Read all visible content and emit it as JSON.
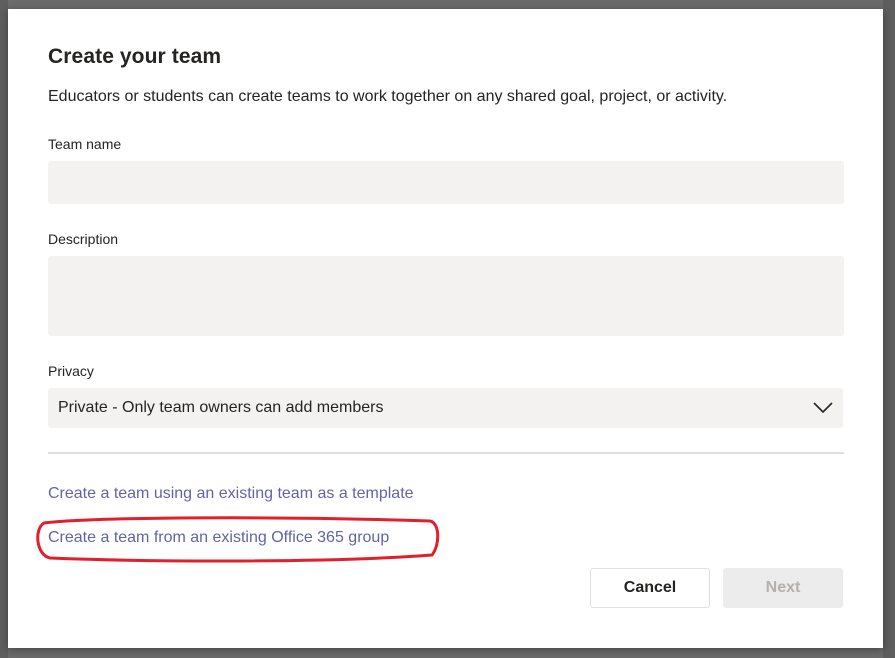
{
  "dialog": {
    "title": "Create your team",
    "subtitle": "Educators or students can create teams to work together on any shared goal, project, or activity."
  },
  "fields": {
    "team_name": {
      "label": "Team name",
      "value": "",
      "placeholder": ""
    },
    "description": {
      "label": "Description",
      "value": "",
      "placeholder": ""
    },
    "privacy": {
      "label": "Privacy",
      "selected": "Private - Only team owners can add members"
    }
  },
  "links": {
    "template": "Create a team using an existing team as a template",
    "office365": "Create a team from an existing Office 365 group"
  },
  "buttons": {
    "cancel": "Cancel",
    "next": "Next"
  },
  "colors": {
    "accent": "#6264a7",
    "highlight": "#e0202a",
    "field_bg": "#f3f2f1"
  },
  "icons": {
    "dropdown": "chevron-down-icon"
  }
}
